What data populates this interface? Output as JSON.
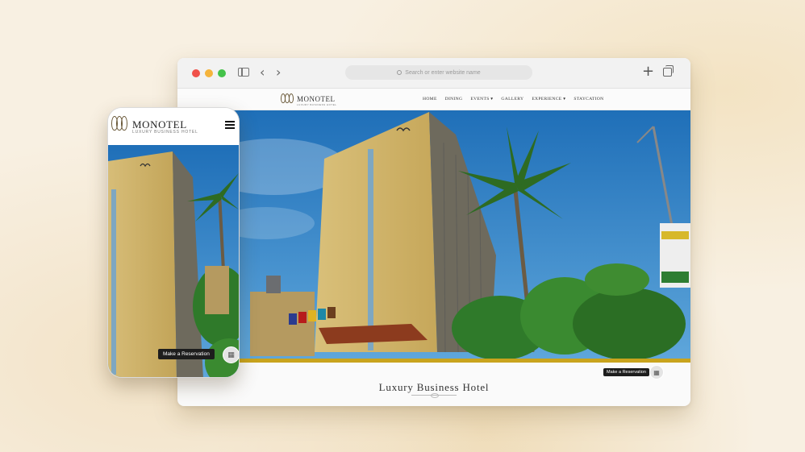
{
  "browser": {
    "url_placeholder": "Search or enter website name",
    "back_glyph": "‹",
    "forward_glyph": "›",
    "new_tab_glyph": "+"
  },
  "site": {
    "logo_text": "MONOTEL",
    "logo_subtitle": "LUXURY BUSINESS HOTEL",
    "nav": [
      "Home",
      "Dining",
      "Events ▾",
      "Gallery",
      "Experience ▾",
      "Staycation"
    ],
    "heading": "Luxury Business Hotel",
    "reservation_label": "Make a Reservation",
    "accent_color": "#c9a41d"
  },
  "phone": {
    "logo_text": "MONOTEL",
    "logo_subtitle": "LUXURY BUSINESS HOTEL",
    "reservation_label": "Make a Reservation"
  },
  "icons": [
    "close-dot",
    "minimize-dot",
    "maximize-dot",
    "sidebar-icon",
    "back-icon",
    "forward-icon",
    "search-icon",
    "plus-icon",
    "tabs-icon",
    "hamburger-icon",
    "calendar-icon"
  ]
}
